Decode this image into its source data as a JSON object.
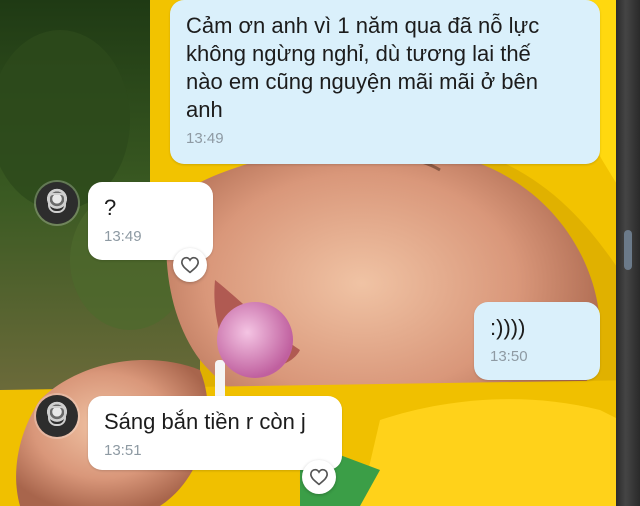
{
  "chat": {
    "messages": [
      {
        "sender": "me",
        "text": "Cảm ơn anh vì 1 năm qua đã nỗ lực\nkhông ngừng nghỉ, dù tương lai thế\nnào em cũng nguyện mãi mãi ở bên\nanh",
        "time": "13:49"
      },
      {
        "sender": "other",
        "text": "?",
        "time": "13:49"
      },
      {
        "sender": "me",
        "text": ":))))",
        "time": "13:50"
      },
      {
        "sender": "other",
        "text": "Sáng bắn tiền r còn j",
        "time": "13:51"
      }
    ]
  },
  "icons": {
    "reaction": "heart-outline-icon",
    "avatar": "profile-avatar"
  },
  "colors": {
    "outgoing_bubble": "#daf0fb",
    "incoming_bubble": "#ffffff",
    "time_text": "#8e9aa3",
    "wallpaper_accent": "#f2c300"
  }
}
